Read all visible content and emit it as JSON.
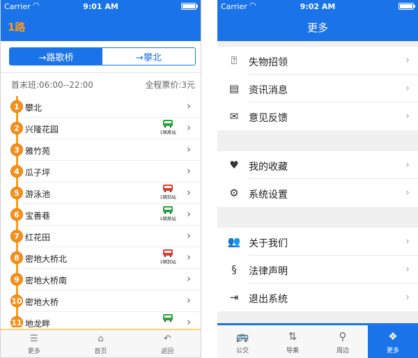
{
  "left": {
    "status": {
      "carrier": "Carrier",
      "time": "9:01 AM"
    },
    "nav_title": "1路",
    "segments": [
      {
        "label": "→路歌桥",
        "active": true
      },
      {
        "label": "→攀北",
        "active": false
      }
    ],
    "first_last_label": "首末班:",
    "first_last_value": "06:00--22:00",
    "fare_label": "全程票价:",
    "fare_value": "3元",
    "stops": [
      {
        "num": "1",
        "name": "攀北",
        "bus": null
      },
      {
        "num": "2",
        "name": "兴隆花园",
        "bus": {
          "color": "green",
          "text": "1辆离站"
        }
      },
      {
        "num": "3",
        "name": "雅竹苑",
        "bus": null
      },
      {
        "num": "4",
        "name": "瓜子坪",
        "bus": null
      },
      {
        "num": "5",
        "name": "游泳池",
        "bus": {
          "color": "red",
          "text": "1辆到站"
        }
      },
      {
        "num": "6",
        "name": "宝善巷",
        "bus": {
          "color": "green",
          "text": "1辆离站"
        }
      },
      {
        "num": "7",
        "name": "红花田",
        "bus": null
      },
      {
        "num": "8",
        "name": "密地大桥北",
        "bus": {
          "color": "red",
          "text": "1辆到站"
        }
      },
      {
        "num": "9",
        "name": "密地大桥南",
        "bus": null
      },
      {
        "num": "10",
        "name": "密地大桥",
        "bus": null
      },
      {
        "num": "11",
        "name": "地龙畔",
        "bus": {
          "color": "green",
          "text": ""
        }
      }
    ],
    "tabs": [
      {
        "label": "更多",
        "icon": "menu-icon"
      },
      {
        "label": "首页",
        "icon": "home-icon"
      },
      {
        "label": "返回",
        "icon": "back-icon"
      }
    ]
  },
  "right": {
    "status": {
      "carrier": "Carrier",
      "time": "9:02 AM"
    },
    "nav_title": "更多",
    "groups": [
      [
        {
          "label": "失物招领",
          "icon": "lost-found-icon",
          "glyph": "⍰"
        },
        {
          "label": "资讯消息",
          "icon": "document-icon",
          "glyph": "▤"
        },
        {
          "label": "意见反馈",
          "icon": "mail-icon",
          "glyph": "✉"
        }
      ],
      [
        {
          "label": "我的收藏",
          "icon": "heart-icon",
          "glyph": "♥"
        },
        {
          "label": "系统设置",
          "icon": "gear-icon",
          "glyph": "⚙"
        }
      ],
      [
        {
          "label": "关于我们",
          "icon": "users-icon",
          "glyph": "👥"
        },
        {
          "label": "法律声明",
          "icon": "law-icon",
          "glyph": "§"
        },
        {
          "label": "退出系统",
          "icon": "logout-icon",
          "glyph": "⇥"
        }
      ]
    ],
    "tabs": [
      {
        "label": "公交",
        "icon": "bus-icon",
        "glyph": "🚌",
        "active": false
      },
      {
        "label": "导乘",
        "icon": "transfer-icon",
        "glyph": "⇅",
        "active": false
      },
      {
        "label": "周边",
        "icon": "nearby-icon",
        "glyph": "⚲",
        "active": false
      },
      {
        "label": "更多",
        "icon": "more-icon",
        "glyph": "❖",
        "active": true
      }
    ]
  },
  "colors": {
    "primary": "#1a73e8",
    "accent_orange": "#f5901d",
    "bus_green": "#25a53b",
    "bus_red": "#e03a2a"
  }
}
